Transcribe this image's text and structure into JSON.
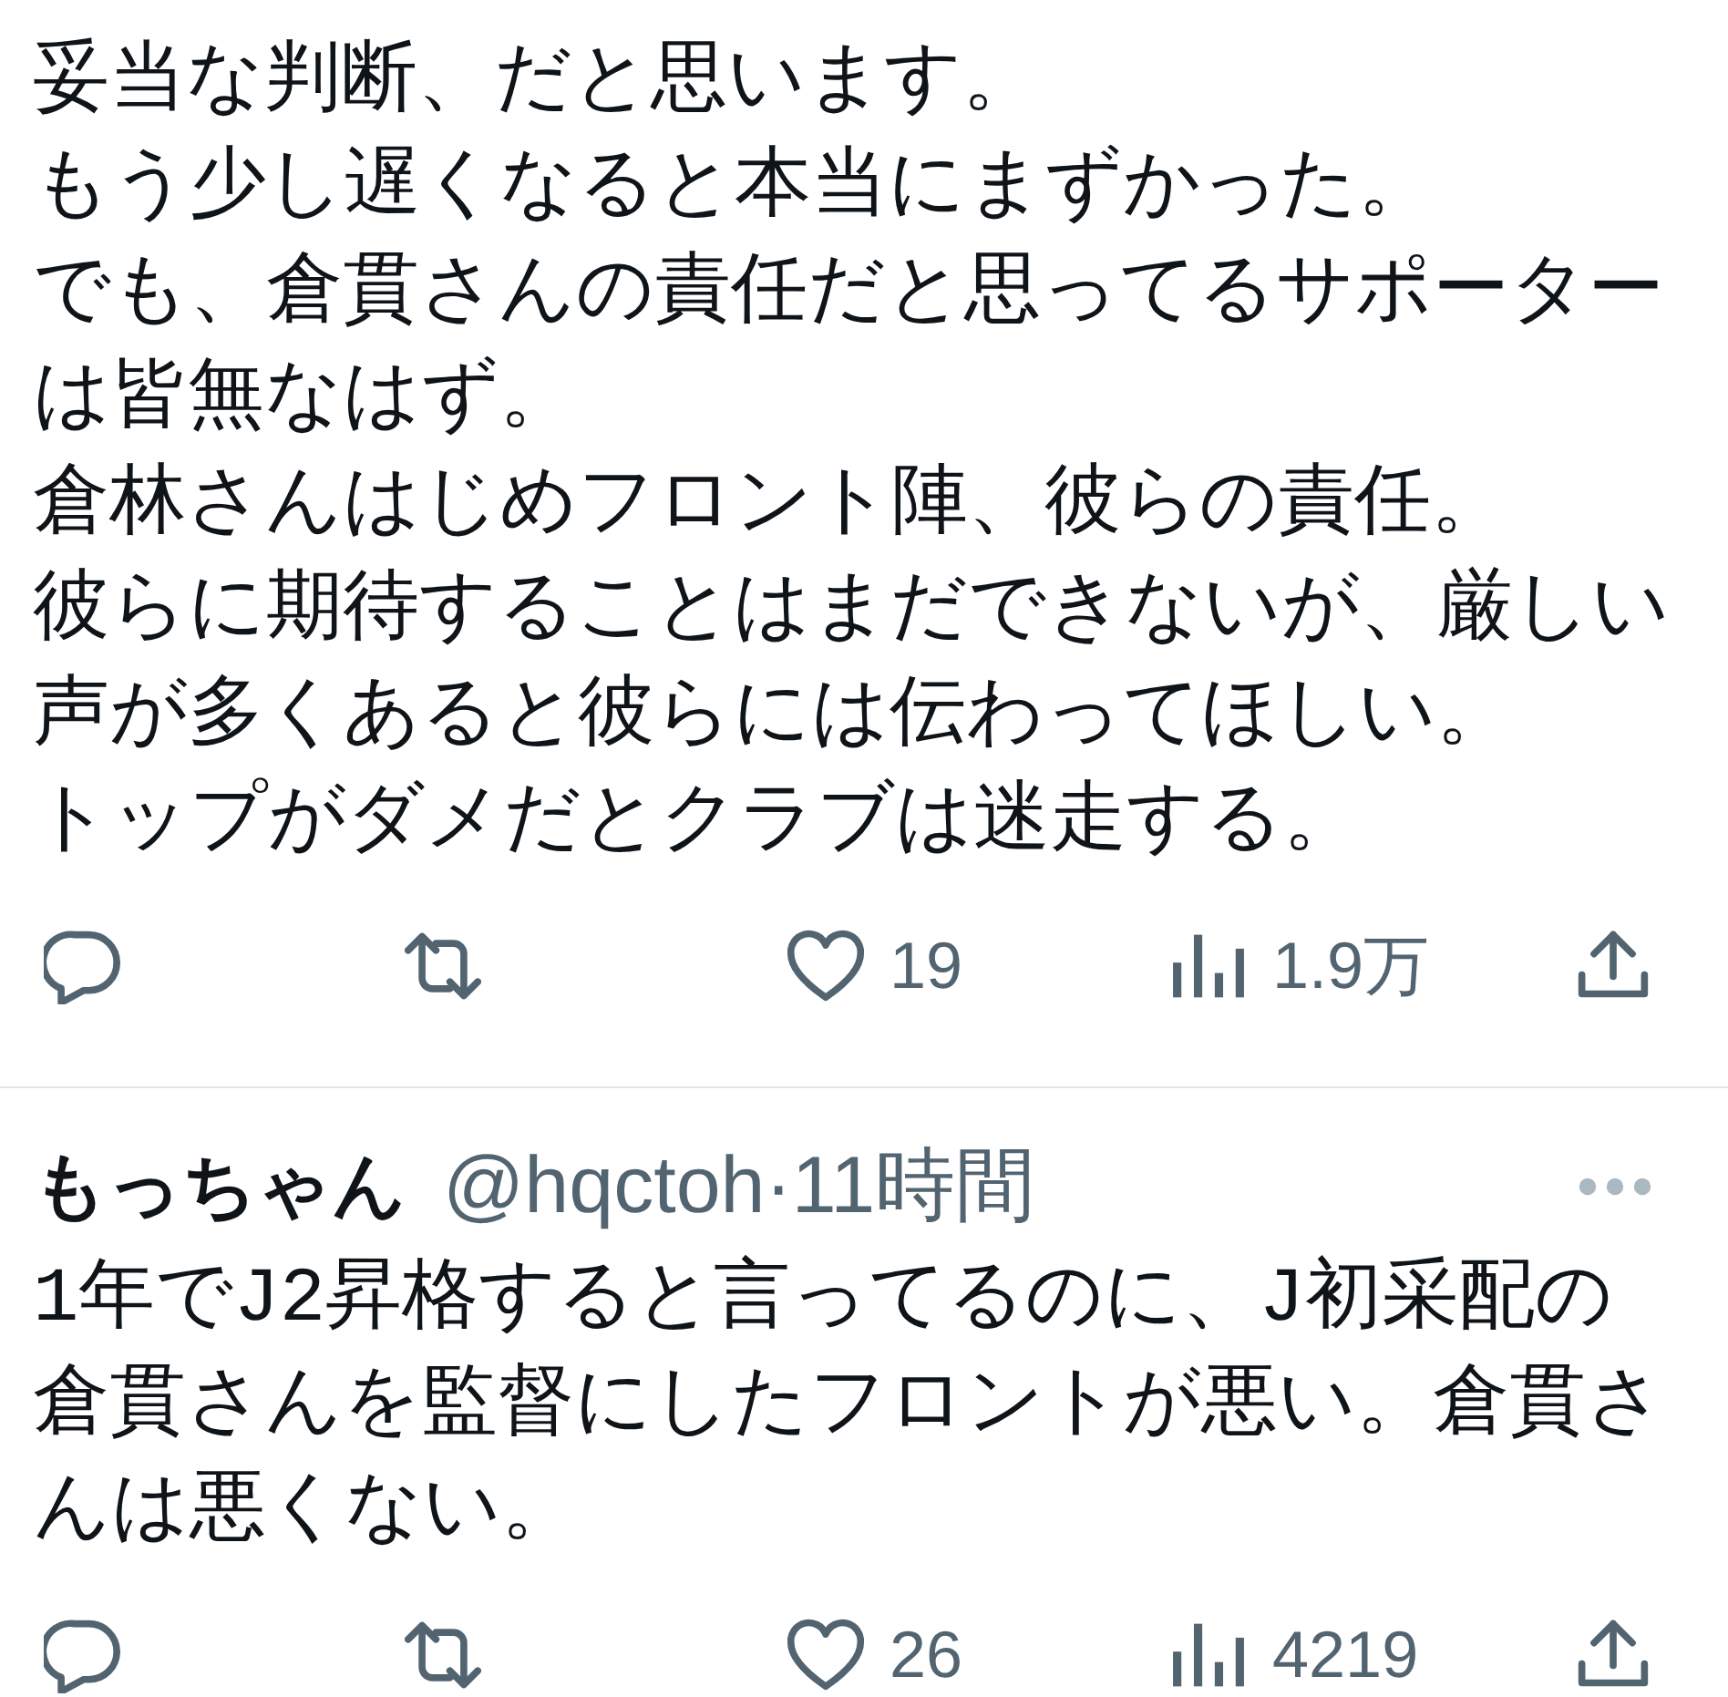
{
  "tweets": [
    {
      "lines": [
        "妥当な判断、だと思います。",
        "もう少し遅くなると本当にまずかった。",
        "でも、倉貫さんの責任だと思ってるサポーターは皆無なはず。",
        "倉林さんはじめフロント陣、彼らの責任。",
        "彼らに期待することはまだできないが、厳しい声が多くあると彼らには伝わってほしい。",
        "トップがダメだとクラブは迷走する。"
      ],
      "actions": [
        {
          "kind": "reply"
        },
        {
          "kind": "repost"
        },
        {
          "kind": "like",
          "count": "19"
        },
        {
          "kind": "views",
          "count": "1.9万"
        },
        {
          "kind": "share"
        }
      ]
    },
    {
      "author": {
        "name": "もっちゃん",
        "handle_time": "@hqctoh·11時間"
      },
      "lines": [
        "1年でJ2昇格すると言ってるのに、J初采配の倉貫さんを監督にしたフロントが悪い。倉貫さんは悪くない。"
      ],
      "actions": [
        {
          "kind": "reply"
        },
        {
          "kind": "repost"
        },
        {
          "kind": "like",
          "count": "26"
        },
        {
          "kind": "views",
          "count": "4219"
        },
        {
          "kind": "share"
        }
      ]
    }
  ]
}
